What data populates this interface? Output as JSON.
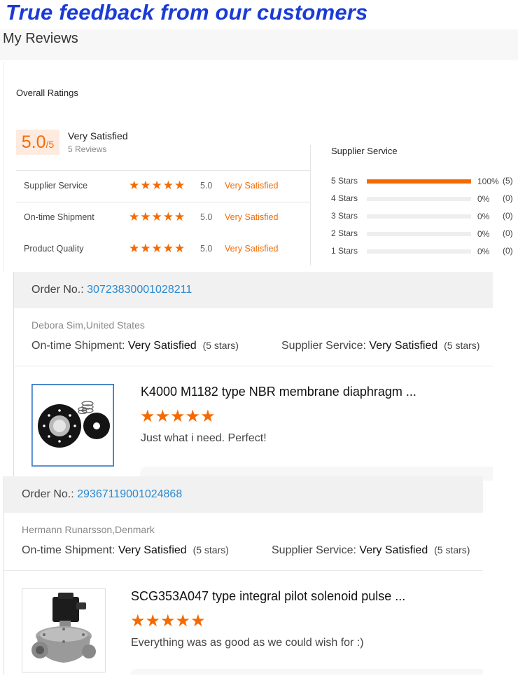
{
  "banner": {
    "text": "True feedback from our customers"
  },
  "header": {
    "title": "My Reviews"
  },
  "summary": {
    "overall_title": "Overall Ratings",
    "score": "5.0",
    "score_max": "/5",
    "satisfaction": "Very Satisfied",
    "reviews_count": "5 Reviews",
    "ratings": [
      {
        "label": "Supplier Service",
        "stars": 5,
        "value": "5.0",
        "text": "Very Satisfied"
      },
      {
        "label": "On-time Shipment",
        "stars": 5,
        "value": "5.0",
        "text": "Very Satisfied"
      },
      {
        "label": "Product Quality",
        "stars": 5,
        "value": "5.0",
        "text": "Very Satisfied"
      }
    ],
    "distribution_title": "Supplier Service",
    "distribution": [
      {
        "label": "5 Stars",
        "percent": "100%",
        "count": "(5)",
        "fill": 1.0
      },
      {
        "label": "4 Stars",
        "percent": "0%",
        "count": "(0)",
        "fill": 0
      },
      {
        "label": "3 Stars",
        "percent": "0%",
        "count": "(0)",
        "fill": 0
      },
      {
        "label": "2 Stars",
        "percent": "0%",
        "count": "(0)",
        "fill": 0
      },
      {
        "label": "1 Stars",
        "percent": "0%",
        "count": "(0)",
        "fill": 0
      }
    ]
  },
  "orders": [
    {
      "order_label": "Order No.:",
      "order_number": "30723830001028211",
      "buyer": "Debora Sim,United States",
      "shipment_label": "On-time Shipment:",
      "shipment_value": "Very Satisfied",
      "shipment_stars": "(5 stars)",
      "service_label": "Supplier Service:",
      "service_value": "Very Satisfied",
      "service_stars": "(5 stars)",
      "product_title": "K4000 M1182 type NBR membrane diaphragm ...",
      "product_stars": 5,
      "comment": "Just what i need. Perfect!",
      "thumb_icon": "diaphragm-kit-image"
    },
    {
      "order_label": "Order No.:",
      "order_number": "29367119001024868",
      "buyer": "Hermann Runarsson,Denmark",
      "shipment_label": "On-time Shipment:",
      "shipment_value": "Very Satisfied",
      "shipment_stars": "(5 stars)",
      "service_label": "Supplier Service:",
      "service_value": "Very Satisfied",
      "service_stars": "(5 stars)",
      "product_title": "SCG353A047 type integral pilot solenoid pulse ...",
      "product_stars": 5,
      "comment": "Everything was as good as we could wish for :)",
      "thumb_icon": "pulse-valve-image"
    }
  ],
  "colors": {
    "accent": "#f56a00",
    "link": "#2a8ad0",
    "banner": "#1a3bd6"
  }
}
